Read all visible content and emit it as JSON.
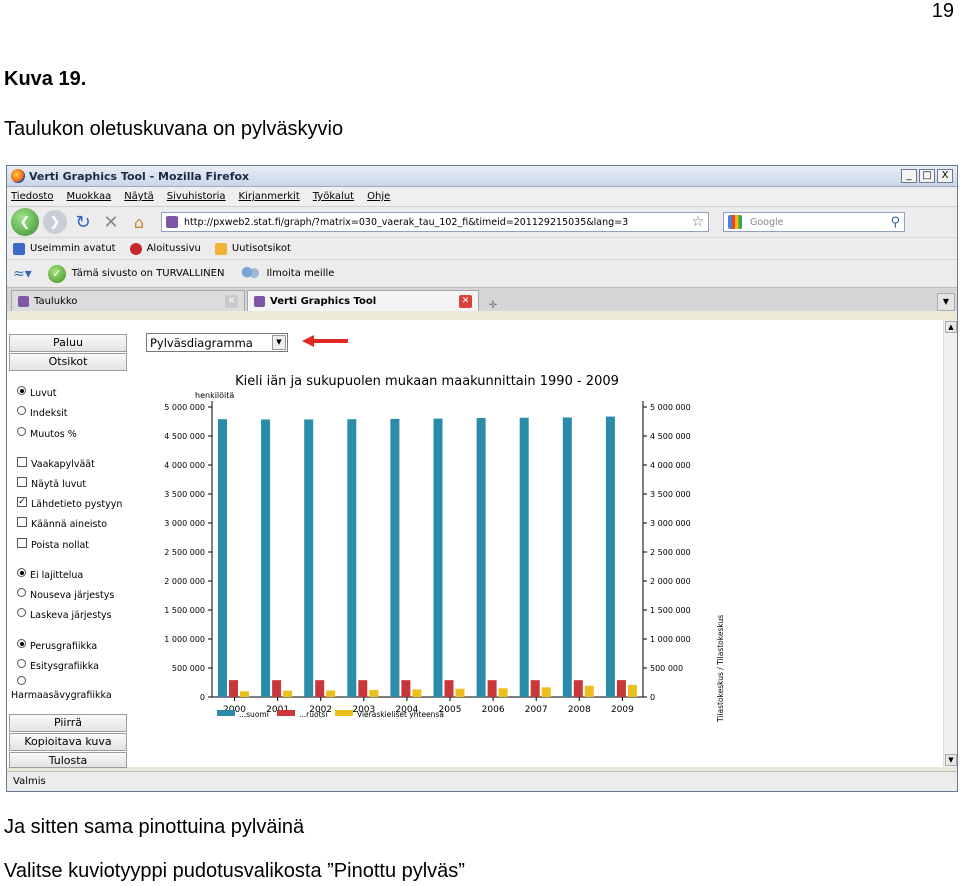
{
  "document": {
    "page_number": "19",
    "figure_label": "Kuva 19.",
    "figure_caption": "Taulukon oletuskuvana on pylväskyvio",
    "after_text_1": "Ja sitten sama pinottuina pylväinä",
    "after_text_2": "Valitse kuviotyyppi pudotusvalikosta ”Pinottu pylväs”"
  },
  "browser": {
    "window_title": "Verti Graphics Tool - Mozilla Firefox",
    "window_buttons": [
      "_",
      "□",
      "X"
    ],
    "menu": [
      "Tiedosto",
      "Muokkaa",
      "Näytä",
      "Sivuhistoria",
      "Kirjanmerkit",
      "Työkalut",
      "Ohje"
    ],
    "url": "http://pxweb2.stat.fi/graph/?matrix=030_vaerak_tau_102_fi&timeid=201129215035&lang=3",
    "search_placeholder": "Google",
    "bookmarks": [
      "Useimmin avatut",
      "Aloitussivu",
      "Uutisotsikot"
    ],
    "security_text": "Tämä sivusto on TURVALLINEN",
    "report_text": "Ilmoita meille",
    "tabs": [
      {
        "label": "Taulukko",
        "active": false
      },
      {
        "label": "Verti Graphics Tool",
        "active": true
      }
    ],
    "status_text": "Valmis"
  },
  "app": {
    "buttons_top": {
      "back": "Paluu",
      "titles": "Otsikot"
    },
    "chart_type_selected": "Pylväsdiagramma",
    "value_options": [
      {
        "label": "Luvut",
        "selected": true
      },
      {
        "label": "Indeksit",
        "selected": false
      },
      {
        "label": "Muutos %",
        "selected": false
      }
    ],
    "checkboxes": [
      {
        "label": "Vaakapylväät",
        "checked": false
      },
      {
        "label": "Näytä luvut",
        "checked": false
      },
      {
        "label": "Lähdetieto pystyyn",
        "checked": true
      },
      {
        "label": "Käännä aineisto",
        "checked": false
      },
      {
        "label": "Poista nollat",
        "checked": false
      }
    ],
    "sort_options": [
      {
        "label": "Ei lajittelua",
        "selected": true
      },
      {
        "label": "Nouseva järjestys",
        "selected": false
      },
      {
        "label": "Laskeva järjestys",
        "selected": false
      }
    ],
    "graphic_options": [
      {
        "label": "Perusgrafiikka",
        "selected": true
      },
      {
        "label": "Esitysgrafiikka",
        "selected": false
      },
      {
        "label": "Harmaasävygrafiikka",
        "selected": false
      }
    ],
    "buttons_bottom": {
      "draw": "Piirrä",
      "copy": "Kopioitava kuva",
      "print": "Tulosta"
    }
  },
  "chart_data": {
    "type": "bar",
    "title": "Kieli iän ja sukupuolen mukaan maakunnittain 1990 - 2009",
    "ylabel": "henkilöitä",
    "source": "Tilastokeskus / Tilastokeskus",
    "ylim": [
      0,
      5000000
    ],
    "yticks": [
      0,
      500000,
      1000000,
      1500000,
      2000000,
      2500000,
      3000000,
      3500000,
      4000000,
      4500000,
      5000000
    ],
    "ytick_labels": [
      "0",
      "500 000",
      "1 000 000",
      "1 500 000",
      "2 000 000",
      "2 500 000",
      "3 000 000",
      "3 500 000",
      "4 000 000",
      "4 500 000",
      "5 000 000"
    ],
    "categories": [
      "2000",
      "2001",
      "2002",
      "2003",
      "2004",
      "2005",
      "2006",
      "2007",
      "2008",
      "2009"
    ],
    "series": [
      {
        "name": "...suomi",
        "color": "#2a8ca8",
        "values": [
          4790000,
          4785000,
          4785000,
          4790000,
          4795000,
          4800000,
          4810000,
          4815000,
          4820000,
          4835000
        ]
      },
      {
        "name": "...ruotsi",
        "color": "#c8373a",
        "values": [
          291000,
          290000,
          290000,
          290000,
          290000,
          290000,
          290000,
          290000,
          290000,
          291000
        ]
      },
      {
        "name": "Vieraskieliset yhteensä",
        "color": "#ecc01c",
        "values": [
          99000,
          109000,
          114000,
          122000,
          130000,
          143000,
          151000,
          167000,
          194000,
          208000
        ]
      }
    ],
    "grid": false,
    "legend": "bottom"
  },
  "colors": {
    "arrow": "#e02a20",
    "frame": "#6a7a92"
  }
}
